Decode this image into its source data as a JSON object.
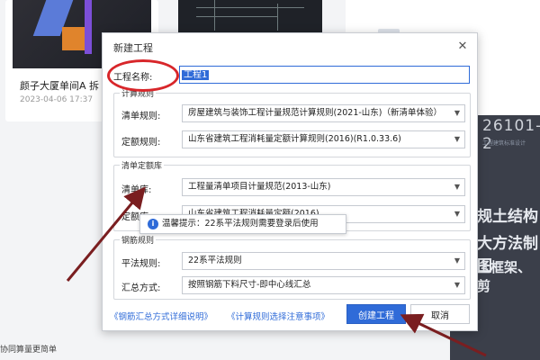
{
  "background": {
    "card1": {
      "title": "颜子大厦单间A 拆",
      "date": "2023-04-06 17:37"
    },
    "right_panel": {
      "line1": "26101-2",
      "line2": "工程建筑标准设计",
      "line3": "规土结构",
      "line4": "大方法制图",
      "line5": "土框架、剪"
    },
    "bottom_text": "协同算量更简单"
  },
  "dialog": {
    "title": "新建工程",
    "close_icon": "close-icon",
    "project_name": {
      "label": "工程名称:",
      "value": "工程1"
    },
    "calc_rules": {
      "title": "计算规则",
      "list_rule": {
        "label": "清单规则:",
        "value": "房屋建筑与装饰工程计量规范计算规则(2021-山东)（新清单体验）"
      },
      "quota_rule": {
        "label": "定额规则:",
        "value": "山东省建筑工程消耗量定额计算规则(2016)(R1.0.33.6)"
      }
    },
    "quota_lib": {
      "title": "清单定额库",
      "list_lib": {
        "label": "清单库:",
        "value": "工程量清单项目计量规范(2013-山东)"
      },
      "quota_lib": {
        "label": "定额库:",
        "value": "山东省建筑工程消耗量定额(2016)"
      }
    },
    "rebar_rules": {
      "title": "钢筋规则",
      "flat_rule": {
        "label": "平法规则:",
        "value": "22系平法规则"
      },
      "summary": {
        "label": "汇总方式:",
        "value": "按照钢筋下料尺寸-即中心线汇总"
      }
    },
    "tooltip": "温馨提示：22系平法规则需要登录后使用",
    "links": {
      "rebar_summary": "《钢筋汇总方式详细说明》",
      "calc_rule_notes": "《计算规则选择注意事项》"
    },
    "buttons": {
      "create": "创建工程",
      "cancel": "取消"
    }
  },
  "colors": {
    "accent": "#2f6bd8",
    "annotation": "#d8262a",
    "arrow": "#7a1e20"
  }
}
